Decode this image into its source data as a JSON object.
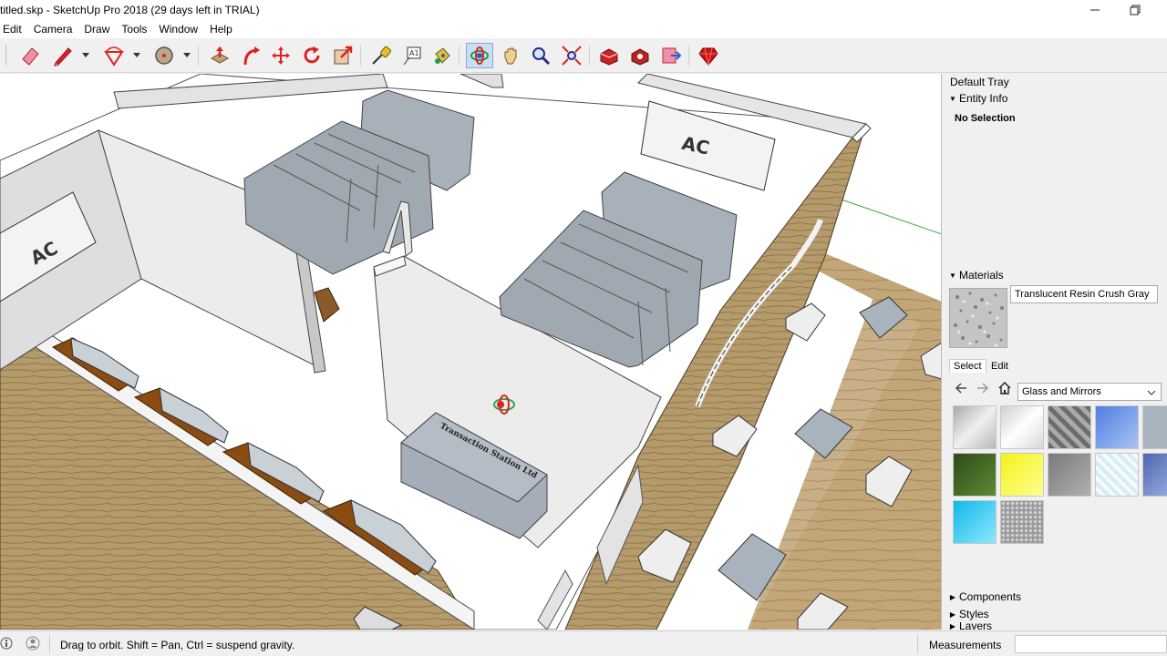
{
  "window": {
    "title": "titled.skp - SketchUp Pro 2018 (29 days left in TRIAL)"
  },
  "menu": [
    "Edit",
    "Camera",
    "Draw",
    "Tools",
    "Window",
    "Help"
  ],
  "toolbar": {
    "tools": [
      {
        "name": "eraser-icon"
      },
      {
        "name": "pencil-icon"
      },
      {
        "name": "arc-icon"
      },
      {
        "name": "circle-icon"
      },
      {
        "name": "push-pull-icon"
      },
      {
        "name": "follow-me-icon"
      },
      {
        "name": "move-icon"
      },
      {
        "name": "rotate-icon"
      },
      {
        "name": "scale-icon"
      },
      {
        "name": "tape-measure-icon"
      },
      {
        "name": "text-icon"
      },
      {
        "name": "paint-bucket-icon"
      },
      {
        "name": "orbit-icon"
      },
      {
        "name": "pan-icon"
      },
      {
        "name": "zoom-icon"
      },
      {
        "name": "zoom-extents-icon"
      },
      {
        "name": "warehouse-icon"
      },
      {
        "name": "extension-warehouse-icon"
      },
      {
        "name": "send-to-layout-icon"
      },
      {
        "name": "ruby-icon"
      }
    ]
  },
  "model": {
    "ac_labels": [
      "AC",
      "AC"
    ],
    "counter_text": "Transaction Station Ltd"
  },
  "tray": {
    "title": "Default Tray",
    "entity_info": {
      "label": "Entity Info",
      "selection": "No Selection"
    },
    "materials": {
      "label": "Materials",
      "current_material": "Translucent Resin Crush Gray",
      "tabs": [
        "Select",
        "Edit"
      ],
      "library": "Glass and Mirrors",
      "swatches": [
        {
          "color": "#cfcfcf"
        },
        {
          "color": "#e4e4e4"
        },
        {
          "color": "#8a8a8a"
        },
        {
          "color": "#6f95e6"
        },
        {
          "color": "#a9b3bd"
        },
        {
          "color": "#3f6224"
        },
        {
          "color": "#f2f21b"
        },
        {
          "color": "#8c8c8c"
        },
        {
          "color": "#d6ecf8"
        },
        {
          "color": "#6d86c6"
        },
        {
          "color": "#27c8ee"
        },
        {
          "color": "#b2b2b2"
        }
      ]
    },
    "collapsed_panels": [
      "Components",
      "Styles",
      "Layers"
    ]
  },
  "status": {
    "message": "Drag to orbit. Shift = Pan, Ctrl = suspend gravity.",
    "measurements_label": "Measurements"
  },
  "colors": {
    "accent": "#c9def5",
    "wall": "#e9e9e9",
    "floor": "#ffffff",
    "wood": "#b59b6c",
    "cabinet": "#a5aeb8"
  }
}
